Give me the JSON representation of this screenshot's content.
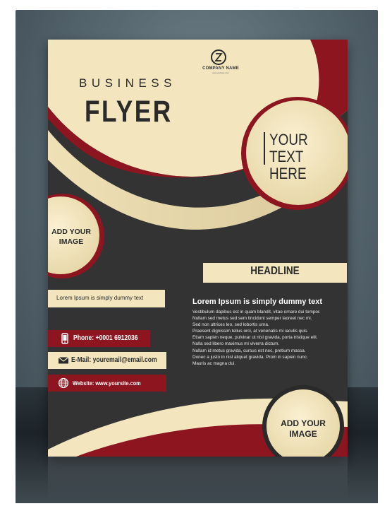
{
  "flyer": {
    "logo": {
      "icon": "company-logo-icon",
      "company_name": "COMPANY NAME",
      "tagline": "www.website.com"
    },
    "title_top": "BUSINESS",
    "title_main": "FLYER",
    "callout_lines": [
      "YOUR",
      "TEXT HERE"
    ],
    "image_placeholder_left": [
      "ADD YOUR",
      "IMAGE"
    ],
    "image_placeholder_bottom": [
      "ADD YOUR",
      "IMAGE"
    ],
    "headline": "HEADLINE",
    "side_caption": "Lorem Ipsum is simply dummy text",
    "subheading": "Lorem Ipsum is simply dummy text",
    "body_lines": [
      "Vestibulum dapibus est in quam blandit, vitae ornare dui tempor.",
      "Nullam sed metus sed sem tincidunt semper laoreet nec mi.",
      "Sed non ultrices leo, sed lobortis urna.",
      "Praesent dignissim tellus orci, at venenatis mi iaculis quis.",
      "Etiam sapien neque, pulvinar ut nisl gravida, porta tristique elit.",
      "Nulla sed libero maximus mi viverra dictum.",
      "Nullam id metus gravida, cursus est nec, pretium massa.",
      "Donec a justo in nisl aliquet gravida. Proin in sapien nunc.",
      "Mauris ac magna dui."
    ],
    "contacts": {
      "phone": {
        "icon": "phone-icon",
        "text": "Phone: +0001 6912036"
      },
      "email": {
        "icon": "envelope-icon",
        "text": "E-Mail: youremail@email.com"
      },
      "website": {
        "icon": "globe-icon",
        "text": "Website: www.yoursite.com"
      }
    }
  },
  "colors": {
    "cream": "#f3e6bf",
    "maroon": "#8c1520",
    "charcoal": "#333333",
    "ink": "#2a2a2a"
  }
}
